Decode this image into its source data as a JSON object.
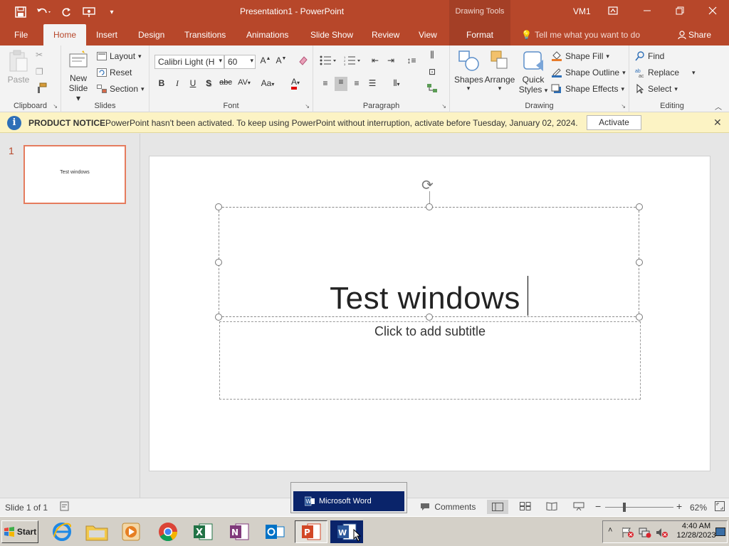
{
  "titlebar": {
    "title": "Presentation1  -  PowerPoint",
    "context_tab": "Drawing Tools",
    "account": "VM1"
  },
  "tabs": {
    "file": "File",
    "home": "Home",
    "insert": "Insert",
    "design": "Design",
    "transitions": "Transitions",
    "animations": "Animations",
    "slideshow": "Slide Show",
    "review": "Review",
    "view": "View",
    "format": "Format",
    "tell_me": "Tell me what you want to do",
    "share": "Share"
  },
  "ribbon": {
    "clipboard": {
      "label": "Clipboard",
      "paste": "Paste"
    },
    "slides": {
      "label": "Slides",
      "new_slide_1": "New",
      "new_slide_2": "Slide",
      "layout": "Layout",
      "reset": "Reset",
      "section": "Section"
    },
    "font": {
      "label": "Font",
      "font_name": "Calibri Light (H",
      "font_size": "60",
      "bold": "B",
      "italic": "I",
      "underline": "U",
      "shadow": "S",
      "strike": "abc",
      "spacing": "AV",
      "case": "Aa",
      "color": "A"
    },
    "paragraph": {
      "label": "Paragraph"
    },
    "drawing": {
      "label": "Drawing",
      "shapes": "Shapes",
      "arrange": "Arrange",
      "quick_1": "Quick",
      "quick_2": "Styles",
      "shape_fill": "Shape Fill",
      "shape_outline": "Shape Outline",
      "shape_effects": "Shape Effects"
    },
    "editing": {
      "label": "Editing",
      "find": "Find",
      "replace": "Replace",
      "select": "Select"
    }
  },
  "notice": {
    "title": "PRODUCT NOTICE",
    "message": "PowerPoint hasn't been activated. To keep using PowerPoint without interruption, activate before Tuesday, January 02, 2024.",
    "button": "Activate"
  },
  "thumbnails": [
    {
      "number": "1",
      "text": "Test windows"
    }
  ],
  "slide": {
    "title": "Test windows",
    "subtitle_placeholder": "Click to add subtitle"
  },
  "status": {
    "slide_info": "Slide 1 of 1",
    "comments": "Comments",
    "zoom": "62%"
  },
  "popup": {
    "label": "Microsoft Word"
  },
  "taskbar": {
    "start": "Start",
    "time": "4:40 AM",
    "date": "12/28/2023"
  },
  "colors": {
    "accent": "#b7472a",
    "context": "#a43f26",
    "notice_bg": "#fcf3c4"
  }
}
